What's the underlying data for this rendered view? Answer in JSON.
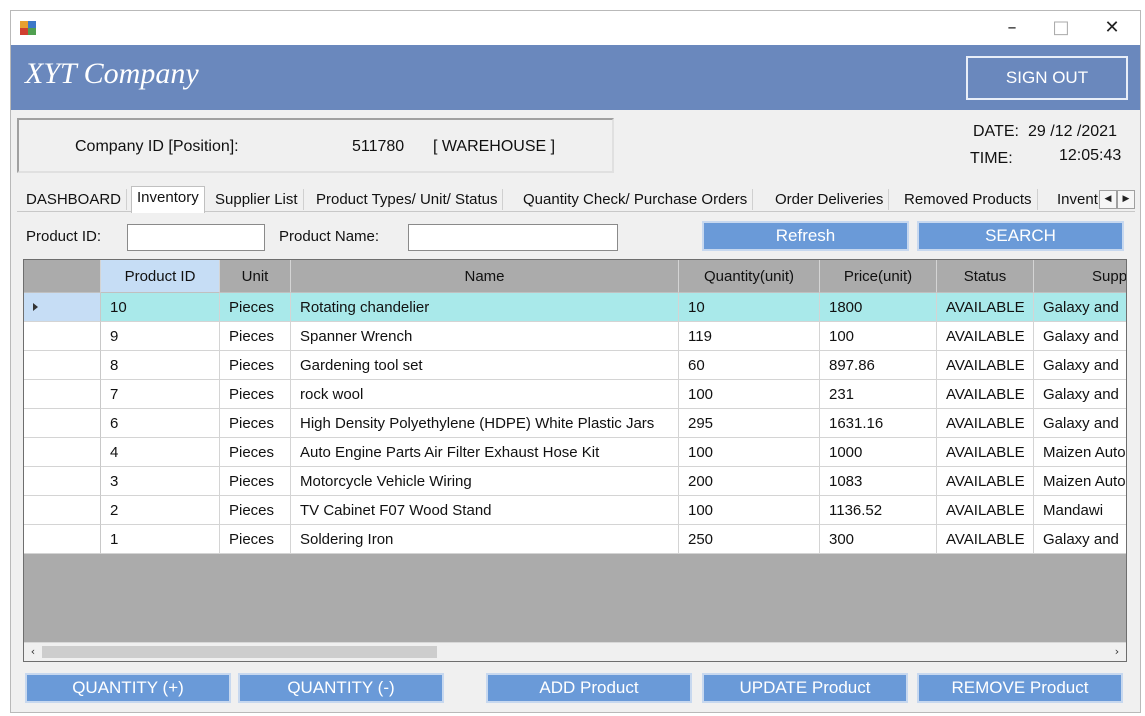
{
  "window": {
    "title": "",
    "app_icon": "form-app-icon",
    "controls": {
      "minimize": "–",
      "maximize": "□",
      "close": "✕"
    }
  },
  "header": {
    "brand": "XYT Company",
    "signout_label": "SIGN OUT",
    "color": "#6a88bd"
  },
  "info": {
    "company_label": "Company ID [Position]:",
    "company_id": "511780",
    "position": "[ WAREHOUSE ]",
    "date_label": "DATE:",
    "date_value": "29 /12 /2021",
    "time_label": "TIME:",
    "time_value": "12:05:43"
  },
  "tabs": [
    {
      "label": "DASHBOARD",
      "active": false
    },
    {
      "label": "Inventory",
      "active": true
    },
    {
      "label": "Supplier List",
      "active": false
    },
    {
      "label": "Product Types/ Unit/ Status",
      "active": false
    },
    {
      "label": "Quantity Check/ Purchase Orders",
      "active": false
    },
    {
      "label": "Order Deliveries",
      "active": false
    },
    {
      "label": "Removed Products",
      "active": false
    },
    {
      "label": "Inventory",
      "active": false
    }
  ],
  "search": {
    "product_id_label": "Product ID:",
    "product_id_value": "",
    "product_name_label": "Product Name:",
    "product_name_value": "",
    "refresh_label": "Refresh",
    "search_label": "SEARCH"
  },
  "table": {
    "columns": [
      "Product ID",
      "Unit",
      "Name",
      "Quantity(unit)",
      "Price(unit)",
      "Status",
      "Supplier"
    ],
    "rows": [
      {
        "id": "10",
        "unit": "Pieces",
        "name": "Rotating chandelier",
        "qty": "10",
        "price": "1800",
        "status": "AVAILABLE",
        "supplier": "Galaxy and",
        "selected": true
      },
      {
        "id": "9",
        "unit": "Pieces",
        "name": "Spanner Wrench",
        "qty": "119",
        "price": "100",
        "status": "AVAILABLE",
        "supplier": "Galaxy and"
      },
      {
        "id": "8",
        "unit": "Pieces",
        "name": "Gardening tool set",
        "qty": "60",
        "price": "897.86",
        "status": "AVAILABLE",
        "supplier": "Galaxy and"
      },
      {
        "id": "7",
        "unit": "Pieces",
        "name": "rock wool",
        "qty": "100",
        "price": "231",
        "status": "AVAILABLE",
        "supplier": "Galaxy and"
      },
      {
        "id": "6",
        "unit": "Pieces",
        "name": "High Density Polyethylene (HDPE) White Plastic Jars",
        "qty": "295",
        "price": "1631.16",
        "status": "AVAILABLE",
        "supplier": "Galaxy and"
      },
      {
        "id": "4",
        "unit": "Pieces",
        "name": "Auto Engine Parts Air Filter Exhaust Hose Kit",
        "qty": "100",
        "price": "1000",
        "status": "AVAILABLE",
        "supplier": "Maizen Auto"
      },
      {
        "id": "3",
        "unit": "Pieces",
        "name": "Motorcycle Vehicle Wiring",
        "qty": "200",
        "price": "1083",
        "status": "AVAILABLE",
        "supplier": "Maizen Auto"
      },
      {
        "id": "2",
        "unit": "Pieces",
        "name": "TV Cabinet F07 Wood Stand",
        "qty": "100",
        "price": "1136.52",
        "status": "AVAILABLE",
        "supplier": "Mandawi"
      },
      {
        "id": "1",
        "unit": "Pieces",
        "name": "Soldering Iron",
        "qty": "250",
        "price": "300",
        "status": "AVAILABLE",
        "supplier": "Galaxy and"
      }
    ]
  },
  "buttons": {
    "quantity_plus": "QUANTITY (+)",
    "quantity_minus": "QUANTITY (-)",
    "add": "ADD Product",
    "update": "UPDATE Product",
    "remove": "REMOVE Product"
  },
  "colors": {
    "selected_row": "#a9e9ea",
    "button_blue": "#6a9ad8"
  }
}
